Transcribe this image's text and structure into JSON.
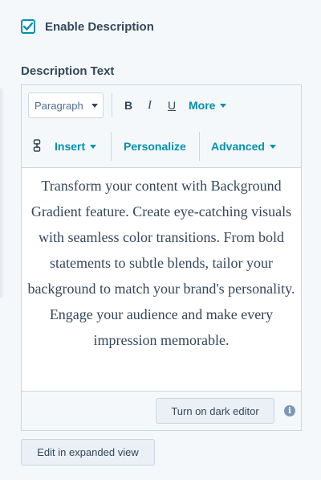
{
  "enable_description": {
    "label": "Enable Description",
    "checked": true
  },
  "section_label": "Description Text",
  "toolbar": {
    "paragraph_select": "Paragraph",
    "bold": "B",
    "italic": "I",
    "underline": "U",
    "more": "More",
    "insert": "Insert",
    "personalize": "Personalize",
    "advanced": "Advanced"
  },
  "content_text": "Transform your content with Background Gradient feature. Create eye-catching visuals with seamless color transitions. From bold statements to subtle blends, tailor your background to match your brand's personality. Engage your audience and make every impression memorable.",
  "footer": {
    "dark_editor_button": "Turn on dark editor",
    "info_icon": "i"
  },
  "expanded_view_button": "Edit in expanded view",
  "colors": {
    "accent": "#0091ae",
    "text": "#33475b",
    "border": "#cbd6e2",
    "background": "#f5f8fa"
  },
  "icons": [
    "checkmark-icon",
    "chevron-down-icon",
    "insert-icon",
    "info-icon"
  ]
}
